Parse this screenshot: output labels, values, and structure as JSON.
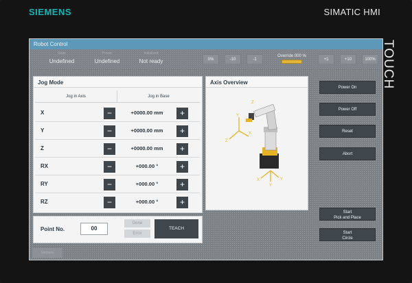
{
  "device": {
    "brand": "SIEMENS",
    "model": "SIMATIC HMI",
    "touch": "TOUCH"
  },
  "window": {
    "title": "Robot Control"
  },
  "status": [
    {
      "label": "State",
      "value": "Undefined"
    },
    {
      "label": "Power",
      "value": "Undefined"
    },
    {
      "label": "Initialized",
      "value": "Not ready"
    }
  ],
  "override_controls": {
    "buttons_left": [
      "0%",
      "-10",
      "-1"
    ],
    "label": "Override 000 %",
    "buttons_right": [
      "+1",
      "+10",
      "100%"
    ],
    "level_percent": 0
  },
  "jog": {
    "title": "Jog Mode",
    "col_axis": "Jog in Axis",
    "col_base": "Jog in Base",
    "minus": "−",
    "plus": "+",
    "rows": [
      {
        "axis": "X",
        "value": "+0000.00 mm"
      },
      {
        "axis": "Y",
        "value": "+0000.00 mm"
      },
      {
        "axis": "Z",
        "value": "+0000.00 mm"
      },
      {
        "axis": "RX",
        "value": "+000.00 °"
      },
      {
        "axis": "RY",
        "value": "+000.00 °"
      },
      {
        "axis": "RZ",
        "value": "+000.00 °"
      }
    ]
  },
  "point": {
    "label": "Point No.",
    "value": "00",
    "done": "Done",
    "error": "Error",
    "teach": "TEACH"
  },
  "axis_overview": {
    "title": "Axis Overview",
    "axes": [
      "Y",
      "X",
      "Z",
      "Z",
      "Y",
      "X",
      "Y"
    ]
  },
  "side_buttons": {
    "power_on": "Power On",
    "power_off": "Power Off",
    "reset": "Reset",
    "abort": "Abort",
    "start_pick_1": "Start",
    "start_pick_2": "Pick and Place",
    "start_circle_1": "Start",
    "start_circle_2": "Circle"
  },
  "bottom": {
    "tab": "Siemens"
  },
  "colors": {
    "titlebar": "#5d98b8",
    "button": "#3f474d",
    "override_bar": "#e3b53d",
    "brand": "#15b5b5"
  }
}
